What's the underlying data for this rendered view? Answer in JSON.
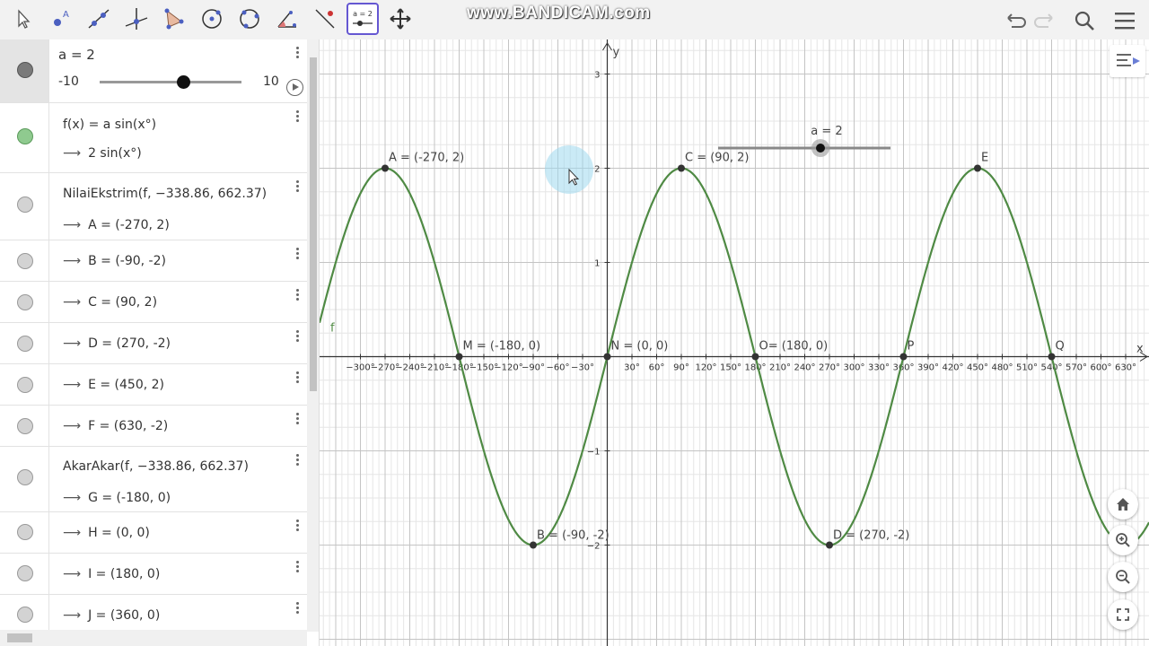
{
  "watermark": "www.BANDICAM.com",
  "toolbar": {
    "tools": [
      "move-tool",
      "point-tool",
      "line-tool",
      "perpendicular-tool",
      "polygon-tool",
      "circle-tool",
      "circle-three-points-tool",
      "angle-tool",
      "reflect-tool",
      "slider-tool",
      "move-graphics-tool"
    ],
    "slider_tool_label": "a = 2"
  },
  "algebra": {
    "slider": {
      "label": "a = 2",
      "min": "-10",
      "max": "10",
      "value": 2
    },
    "function": {
      "definition": "f(x) = a sin(x°)",
      "value": "2 sin(x°)"
    },
    "extremum": {
      "command": "NilaiEkstrim(f, −338.86, 662.37)"
    },
    "points": [
      {
        "name": "A",
        "text": "A = (-270, 2)"
      },
      {
        "name": "B",
        "text": "B = (-90, -2)"
      },
      {
        "name": "C",
        "text": "C = (90, 2)"
      },
      {
        "name": "D",
        "text": "D = (270, -2)"
      },
      {
        "name": "E",
        "text": "E = (450, 2)"
      },
      {
        "name": "F",
        "text": "F = (630, -2)"
      }
    ],
    "roots": {
      "command": "AkarAkar(f, −338.86, 662.37)"
    },
    "root_points": [
      {
        "name": "G",
        "text": "G = (-180, 0)"
      },
      {
        "name": "H",
        "text": "H = (0, 0)"
      },
      {
        "name": "I",
        "text": "I = (180, 0)"
      },
      {
        "name": "J",
        "text": "J = (360, 0)"
      }
    ]
  },
  "graphics": {
    "axis_x_label": "x",
    "axis_y_label": "y",
    "function_label": "f",
    "curve_color": "#4f8a44",
    "x_ticks": [
      "−300°",
      "−270°",
      "−240°",
      "−210°",
      "−180°",
      "−150°",
      "−120°",
      "−90°",
      "−60°",
      "−30°",
      "30°",
      "60°",
      "90°",
      "120°",
      "150°",
      "180°",
      "210°",
      "240°",
      "270°",
      "300°",
      "330°",
      "360°",
      "390°",
      "420°",
      "450°",
      "480°",
      "510°",
      "540°",
      "570°",
      "600°",
      "630°"
    ],
    "y_ticks": [
      "3",
      "2",
      "1",
      "−1",
      "−2"
    ],
    "point_labels": {
      "A": "A = (-270, 2)",
      "B": "B = (-90, -2)",
      "C": "C = (90, 2)",
      "D": "D = (270, -2)",
      "E": "E",
      "M": "M = (-180, 0)",
      "N": "N = (0, 0)",
      "O": "O= (180, 0)",
      "P": "P",
      "Q": "Q"
    },
    "slider_label": "a = 2"
  },
  "chart_data": {
    "type": "line",
    "function": "f(x) = 2 sin(x°)",
    "xlim": [
      -330,
      645
    ],
    "ylim": [
      -3,
      3
    ],
    "extrema": [
      {
        "name": "A",
        "x": -270,
        "y": 2
      },
      {
        "name": "B",
        "x": -90,
        "y": -2
      },
      {
        "name": "C",
        "x": 90,
        "y": 2
      },
      {
        "name": "D",
        "x": 270,
        "y": -2
      },
      {
        "name": "E",
        "x": 450,
        "y": 2
      }
    ],
    "roots": [
      {
        "name": "M",
        "x": -180,
        "y": 0
      },
      {
        "name": "N",
        "x": 0,
        "y": 0
      },
      {
        "name": "O",
        "x": 180,
        "y": 0
      },
      {
        "name": "P",
        "x": 360,
        "y": 0
      },
      {
        "name": "Q",
        "x": 540,
        "y": 0
      }
    ],
    "grid": true
  }
}
